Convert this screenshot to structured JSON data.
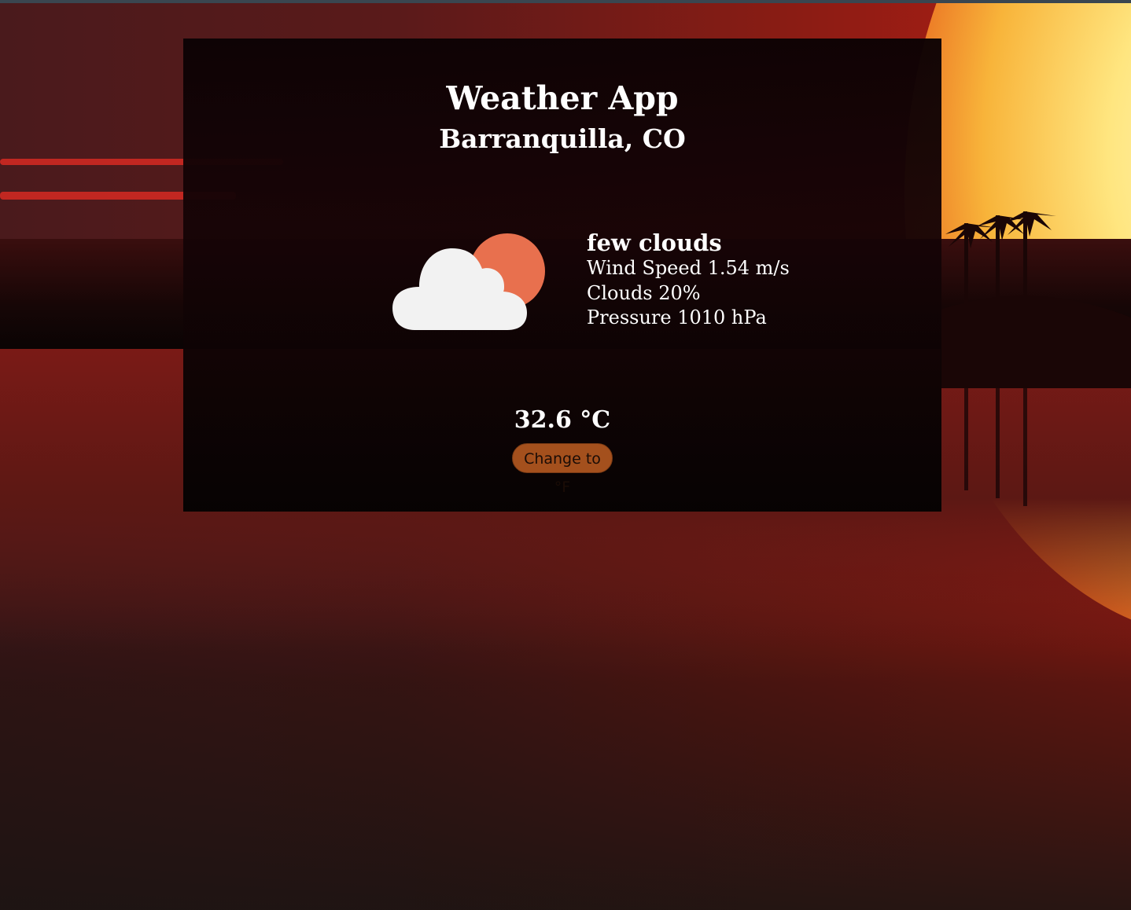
{
  "app": {
    "title": "Weather App",
    "location": "Barranquilla, CO"
  },
  "weather": {
    "icon": "few-clouds-day-icon",
    "description": "few clouds",
    "wind_speed": "Wind Speed 1.54 m/s",
    "clouds": "Clouds 20%",
    "pressure": "Pressure 1010 hPa",
    "temperature": "32.6 °C"
  },
  "controls": {
    "toggle_unit_label": "Change to °F"
  },
  "colors": {
    "sun_icon": "#e8704e",
    "cloud_icon": "#f2f2f2",
    "button_bg": "#a4501d"
  }
}
